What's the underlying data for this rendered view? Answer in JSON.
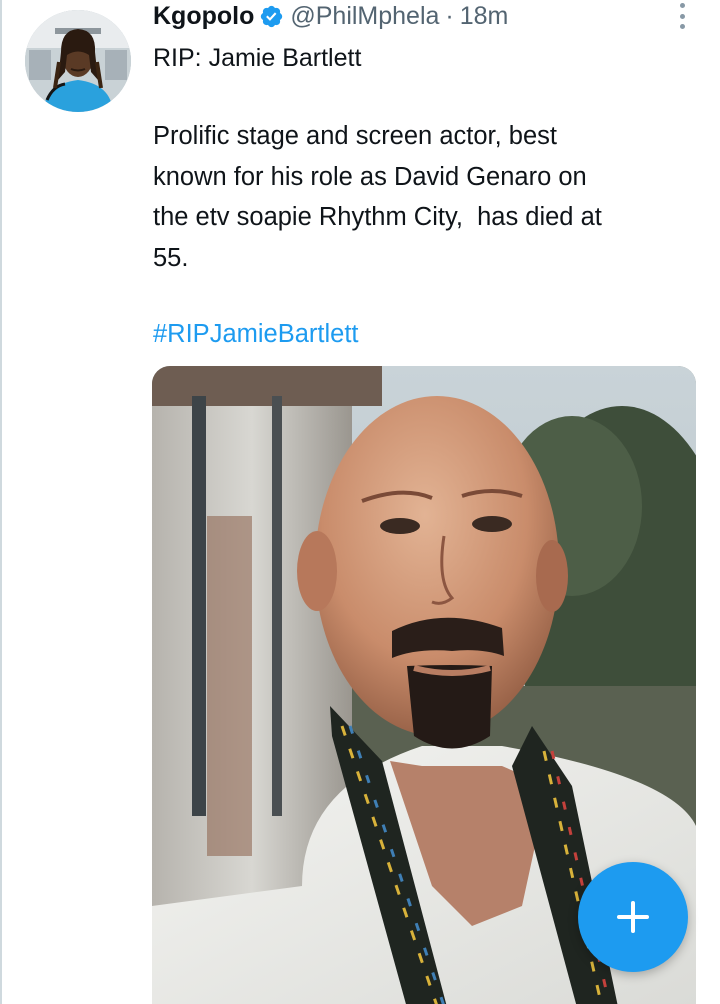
{
  "tweet": {
    "author": {
      "name": "Kgopolo",
      "handle": "@PhilMphela",
      "verified": true
    },
    "separator": "·",
    "time": "18m",
    "title": "RIP: Jamie Bartlett",
    "body": "Prolific stage and screen actor, best\nknown for his role as David Genaro on\nthe etv soapie Rhythm City,  has died at\n55.",
    "hashtag": "#RIPJamieBartlett",
    "media": {
      "icon": "photo-of-man-in-white-shirt"
    }
  },
  "icons": {
    "more": "more-vertical-icon",
    "verified": "verified-badge-icon",
    "compose": "plus-icon"
  },
  "colors": {
    "link": "#1d9bf0",
    "fab": "#1d9bf0",
    "muted": "#536471",
    "text": "#0f1419"
  }
}
